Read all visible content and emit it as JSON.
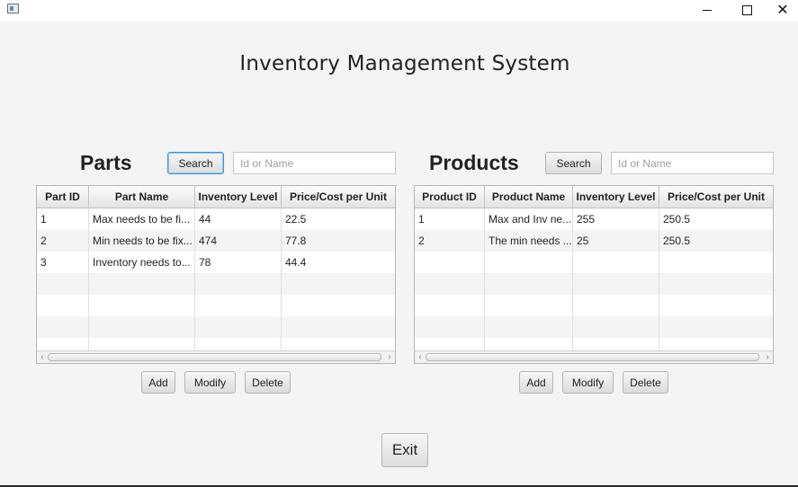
{
  "window": {
    "minimize": "—",
    "maximize": "☐",
    "close": "✕"
  },
  "app_title": "Inventory Management System",
  "parts": {
    "title": "Parts",
    "search_label": "Search",
    "search_placeholder": "Id or Name",
    "columns": [
      "Part ID",
      "Part Name",
      "Inventory Level",
      "Price/Cost per Unit"
    ],
    "rows": [
      [
        "1",
        "Max needs to be fi...",
        "44",
        "22.5"
      ],
      [
        "2",
        "Min needs to be fix...",
        "474",
        "77.8"
      ],
      [
        "3",
        "Inventory needs to...",
        "78",
        "44.4"
      ]
    ],
    "add_label": "Add",
    "modify_label": "Modify",
    "delete_label": "Delete"
  },
  "products": {
    "title": "Products",
    "search_label": "Search",
    "search_placeholder": "Id or Name",
    "columns": [
      "Product ID",
      "Product Name",
      "Inventory Level",
      "Price/Cost per Unit"
    ],
    "rows": [
      [
        "1",
        "Max and Inv ne...",
        "255",
        "250.5"
      ],
      [
        "2",
        "The min needs ...",
        "25",
        "250.5"
      ]
    ],
    "add_label": "Add",
    "modify_label": "Modify",
    "delete_label": "Delete"
  },
  "exit_label": "Exit",
  "scroll_left": "‹",
  "scroll_right": "›"
}
